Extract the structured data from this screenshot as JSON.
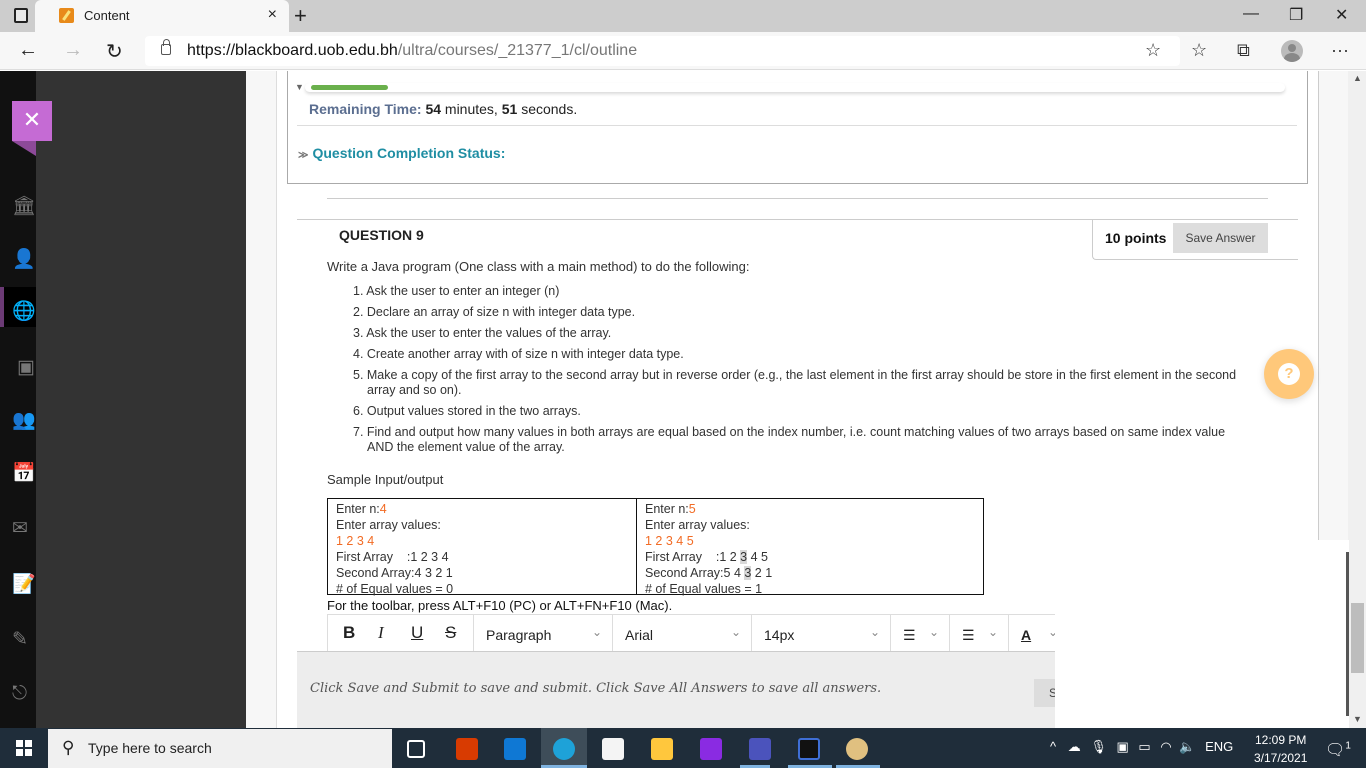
{
  "browser": {
    "tab_title": "Content",
    "tab_close": "×",
    "new_tab": "+",
    "url_host": "https://blackboard.uob.edu.bh",
    "url_path": "/ultra/courses/_21377_1/cl/outline",
    "window_controls": {
      "minimize": "—",
      "restore": "❐",
      "close": "✕"
    },
    "nav": {
      "back": "←",
      "forward": "→",
      "refresh": "↻"
    },
    "toolbar_icons": [
      "add-favorite-icon",
      "favorites-icon",
      "collections-icon",
      "profile-icon",
      "more-icon"
    ],
    "more_label": "···"
  },
  "sidebar": {
    "close_label": "✕",
    "items": [
      {
        "name": "institution",
        "glyph": "🏛"
      },
      {
        "name": "profile",
        "glyph": "👤"
      },
      {
        "name": "activity",
        "glyph": "🌐"
      },
      {
        "name": "courses",
        "glyph": "▣",
        "active": true
      },
      {
        "name": "organizations",
        "glyph": "👥"
      },
      {
        "name": "calendar",
        "glyph": "📅"
      },
      {
        "name": "messages",
        "glyph": "✉"
      },
      {
        "name": "grades",
        "glyph": "📝"
      },
      {
        "name": "tools",
        "glyph": "✎"
      },
      {
        "name": "sign-out",
        "glyph": "⎋"
      }
    ]
  },
  "timer": {
    "progress_fraction": 0.08,
    "remaining_label": "Remaining Time:",
    "minutes": "54",
    "minutes_unit": "minutes,",
    "seconds": "51",
    "seconds_unit": "seconds.",
    "completion_status_label": "Question Completion Status:"
  },
  "question": {
    "title": "QUESTION 9",
    "points": "10 points",
    "save_answer": "Save Answer",
    "intro": "Write a Java program (One class with a main method) to do the following:",
    "steps": [
      "1. Ask the user to enter an integer (n)",
      "2. Declare an array of size n with integer data type.",
      "3. Ask the user to enter the values of the array.",
      "4. Create another array with of size n with integer data type.",
      "5. Make a copy of the first array to the second array but in reverse order (e.g., the last element in the first array should be store in the first element in the second array and so on).",
      "6. Output values stored in the two arrays.",
      "7. Find and output how many values in both arrays are equal based on the index number, i.e. count matching values of two arrays based on same index value AND the element value of the array."
    ],
    "sample_label": "Sample Input/output",
    "samples": [
      {
        "enter_n_label": "Enter n:",
        "n": "4",
        "enter_values_label": "Enter array values:",
        "input_values": "1 2 3 4",
        "first_array_label": "First Array    :",
        "first_array": "1 2 3 4",
        "second_array_label": "Second Array:",
        "second_array": "4 3 2 1",
        "equal_label": "# of Equal values = ",
        "equal_count": "0"
      },
      {
        "enter_n_label": "Enter n:",
        "n": "5",
        "enter_values_label": "Enter array values:",
        "input_values": "1 2 3 4 5",
        "first_array_label": "First Array    :",
        "first_array_pre": "1 2 ",
        "first_array_hl": "3",
        "first_array_post": " 4 5",
        "second_array_label": "Second Array:",
        "second_array_pre": "5 4 ",
        "second_array_hl": "3",
        "second_array_post": " 2 1",
        "equal_label": "# of Equal values = ",
        "equal_count": "1"
      }
    ],
    "toolbar_hint": "For the toolbar, press ALT+F10 (PC) or ALT+FN+F10 (Mac)."
  },
  "editor": {
    "bold": "B",
    "italic": "I",
    "underline": "U",
    "strike": "S",
    "format_select": "Paragraph",
    "font_select": "Arial",
    "size_select": "14px",
    "caret": "⌄",
    "bullet_list": "☰",
    "numbered_list": "☰",
    "text_color": "A"
  },
  "submit": {
    "instruction": "Click Save and Submit to save and submit. Click Save All Answers to save all answers.",
    "button_partial": "S"
  },
  "help_button": "?",
  "taskbar": {
    "search_placeholder": "Type here to search",
    "apps": [
      "task-view",
      "office",
      "mail",
      "edge",
      "store",
      "file-explorer",
      "intellij-toolbox",
      "teams",
      "intellij",
      "paint"
    ],
    "tray": {
      "chevron": "^",
      "language": "ENG"
    },
    "time": "12:09 PM",
    "date": "3/17/2021",
    "notification_count": "1"
  }
}
